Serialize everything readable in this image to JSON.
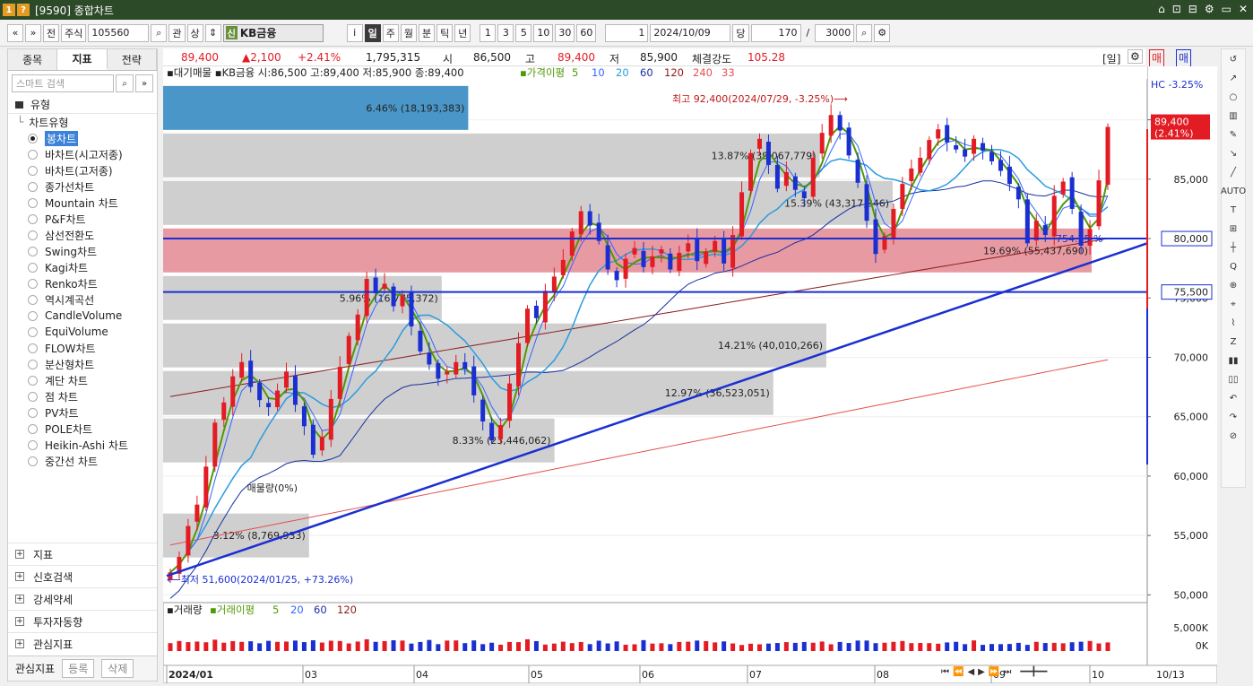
{
  "window": {
    "title": "[9590] 종합차트",
    "code_badge": "1",
    "help_badge": "?",
    "ctrl_icons": [
      "⌂",
      "⊡",
      "⊟",
      "⚙",
      "▭",
      "✕"
    ]
  },
  "toolbar": {
    "nav_prev": "«",
    "nav_down": "»",
    "btn_jeon": "전",
    "market": "주식",
    "code": "105560",
    "btn_search": "⌕",
    "btn_gwan": "관",
    "btn_sang": "상",
    "btn_updown": "⇕",
    "stock_tag": "신",
    "stock_name": "KB금융",
    "btn_info": "i",
    "periods": [
      "일",
      "주",
      "월",
      "분",
      "틱",
      "년"
    ],
    "intervals": [
      "1",
      "3",
      "5",
      "10",
      "30",
      "60"
    ],
    "count_sel": "1",
    "date": "2024/10/09",
    "btn_dang": "당",
    "bars": "170",
    "slash": "/",
    "max_bars": "3000"
  },
  "left_panel": {
    "tabs": [
      "종목",
      "지표",
      "전략"
    ],
    "active_tab": 1,
    "search_placeholder": "스마트 검색",
    "section": "유형",
    "tree_root": "차트유형",
    "chart_types": [
      "봉차트",
      "바차트(시고저종)",
      "바차트(고저종)",
      "종가선차트",
      "Mountain 차트",
      "P&F차트",
      "삼선전환도",
      "Swing차트",
      "Kagi차트",
      "Renko차트",
      "역시계곡선",
      "CandleVolume",
      "EquiVolume",
      "FLOW차트",
      "분산형차트",
      "계단 차트",
      "점 차트",
      "PV차트",
      "POLE차트",
      "Heikin-Ashi 차트",
      "중간선 차트"
    ],
    "selected": 0,
    "lower_sections": [
      "지표",
      "신호검색",
      "강세약세",
      "투자자동향",
      "관심지표"
    ],
    "footer": {
      "label": "관심지표",
      "register": "등록",
      "delete": "삭제"
    }
  },
  "quote": {
    "price": "89,400",
    "change": "▲2,100",
    "rate": "+2.41%",
    "volume": "1,795,315",
    "open_label": "시",
    "open": "86,500",
    "high_label": "고",
    "high": "89,400",
    "low_label": "저",
    "low": "85,900",
    "strength_label": "체결강도",
    "strength": "105.28",
    "mode": "[일]",
    "buy": "매수",
    "sell": "매도"
  },
  "legend": {
    "main": "▪대기매물 ▪KB금융 시:86,500 고:89,400 저:85,900 종:89,400",
    "ma_label": "▪가격이평",
    "ma": [
      "5",
      "10",
      "20",
      "60",
      "120",
      "240",
      "33"
    ],
    "volume_label": "▪거래량",
    "vol_ma_label": "▪거래이평",
    "vol_ma": [
      "5",
      "20",
      "60",
      "120"
    ],
    "hc": "HC  -3.25%"
  },
  "colors": {
    "up": "#e31b23",
    "down": "#1a2fd1",
    "ma5": "#4e9a06",
    "ma10": "#3465ff",
    "ma20": "#2a9be0",
    "ma60": "#1a2fa0",
    "ma120": "#8b1a1a",
    "ma240": "#e35050"
  },
  "chart_data": {
    "type": "candlestick",
    "title": "KB금융",
    "x_labels": [
      "2024/01",
      "03",
      "04",
      "05",
      "06",
      "07",
      "08",
      "09",
      "10"
    ],
    "last_date_label": "10/13",
    "y_ticks": [
      50000,
      55000,
      60000,
      65000,
      70000,
      75000,
      80000,
      85000,
      90000
    ],
    "y_tick_labels": [
      "50,000",
      "55,000",
      "60,000",
      "65,000",
      "70,000",
      "75,000",
      "80,000",
      "85,000",
      "90,000"
    ],
    "ylim": [
      49500,
      94500
    ],
    "current_price_tag": "89,400",
    "current_rate_tag": "(2.41%)",
    "hlines": [
      {
        "value": 80000,
        "label": "80,000"
      },
      {
        "value": 75500,
        "label": "75,500"
      }
    ],
    "annotations": {
      "high": "최고 92,400(2024/07/29, -3.25%)⟶",
      "low": "⟵최저 51,600(2024/01/25, +73.26%)",
      "trend_label": "754.25 %",
      "bar_label_partial": "29.58"
    },
    "volume_profile": [
      {
        "price_low": 89000,
        "price_high": 93000,
        "label": "6.46% (18,193,383)",
        "fraction": 0.46
      },
      {
        "price_low": 85000,
        "price_high": 89000,
        "label": "13.87% (39,067,779)",
        "fraction": 0.99
      },
      {
        "price_low": 81000,
        "price_high": 85000,
        "label": "15.39% (43,317,846)",
        "fraction": 1.1
      },
      {
        "price_low": 77000,
        "price_high": 81000,
        "label": "19.69% (55,437,690)",
        "fraction": 1.4
      },
      {
        "price_low": 73000,
        "price_high": 77000,
        "label": "5.96% (16,775,372)",
        "fraction": 0.42
      },
      {
        "price_low": 69000,
        "price_high": 73000,
        "label": "14.21% (40,010,266)",
        "fraction": 1.0
      },
      {
        "price_low": 65000,
        "price_high": 69000,
        "label": "12.97% (36,523,051)",
        "fraction": 0.92
      },
      {
        "price_low": 61000,
        "price_high": 65000,
        "label": "8.33% (23,446,062)",
        "fraction": 0.59
      },
      {
        "price_low": 57000,
        "price_high": 61000,
        "label": "매물량(0%)",
        "fraction": 0.0
      },
      {
        "price_low": 53000,
        "price_high": 57000,
        "label": "3.12% (8,769,933)",
        "fraction": 0.22
      }
    ],
    "volume_axis": [
      "5,000K",
      "0K"
    ],
    "closes": [
      51900,
      53200,
      55800,
      57600,
      60800,
      64500,
      66200,
      68400,
      69600,
      67500,
      66400,
      65800,
      67200,
      68800,
      66000,
      64200,
      61800,
      63300,
      66500,
      69200,
      71800,
      73600,
      76600,
      75400,
      76200,
      74300,
      75200,
      72600,
      70500,
      69400,
      68200,
      68800,
      69600,
      69000,
      66800,
      64600,
      63000,
      64300,
      67800,
      71200,
      74100,
      73300,
      75600,
      76800,
      78200,
      80600,
      82300,
      81100,
      79800,
      77400,
      76500,
      78300,
      79200,
      77600,
      78500,
      79100,
      77400,
      78800,
      79600,
      78100,
      78900,
      79800,
      77900,
      80300,
      83900,
      87200,
      88400,
      86200,
      84200,
      85600,
      84100,
      83400,
      86800,
      88900,
      90400,
      89100,
      87000,
      84700,
      81500,
      78700,
      80200,
      82500,
      84600,
      85900,
      86800,
      88300,
      89200,
      88100,
      87500,
      86900,
      88400,
      87400,
      86500,
      85700,
      84600,
      83300,
      79600,
      81500,
      80300,
      83600,
      84800,
      82500,
      79400,
      80800,
      84900,
      89400
    ],
    "ma120_start": 66700,
    "ma120_end": 80000,
    "ma240_start": 54200,
    "ma240_end": 69800
  },
  "volume_data": [
    0.55,
    0.7,
    0.62,
    0.66,
    0.61,
    0.79,
    0.58,
    0.69,
    0.64,
    0.68,
    0.54,
    0.71,
    0.64,
    0.66,
    0.73,
    0.62,
    0.75,
    0.59,
    0.72,
    0.7,
    0.53,
    0.66,
    0.82,
    0.64,
    0.69,
    0.75,
    0.73,
    0.52,
    0.63,
    0.77,
    0.48,
    0.73,
    0.74,
    0.55,
    0.74,
    0.48,
    0.58,
    0.44,
    0.63,
    0.62,
    0.82,
    0.69,
    0.45,
    0.52,
    0.65,
    0.55,
    0.63,
    0.48,
    0.72,
    0.53,
    0.67,
    0.44,
    0.47,
    0.76,
    0.52,
    0.54,
    0.48,
    0.63,
    0.65,
    0.73,
    0.69,
    0.6,
    0.67,
    0.53,
    0.42,
    0.51,
    0.47,
    0.52,
    0.56,
    0.62,
    0.57,
    0.63,
    0.58,
    0.66,
    0.47,
    0.63,
    0.56,
    0.73,
    0.73,
    0.55,
    0.58,
    0.64,
    0.7,
    0.55,
    0.56,
    0.55,
    0.51,
    0.6,
    0.64,
    0.48,
    0.74,
    0.43,
    0.49,
    0.48,
    0.49,
    0.57,
    0.43,
    0.64,
    0.56,
    0.57,
    0.54,
    0.61,
    0.65,
    0.7,
    0.53,
    0.6
  ],
  "nav": {
    "buttons": [
      "⏮",
      "⏪",
      "◀",
      "▶",
      "⏩",
      "⏭"
    ],
    "zoom": "━━╋━━"
  },
  "right_tools": [
    "↺",
    "↗",
    "○",
    "▥",
    "✎",
    "↘",
    "╱",
    "AUTO",
    "T",
    "⊞",
    "┼",
    "Q",
    "⊕",
    "⌖",
    "⌇",
    "Z",
    "▮▮",
    "▯▯",
    "↶",
    "↷",
    "⊘"
  ]
}
